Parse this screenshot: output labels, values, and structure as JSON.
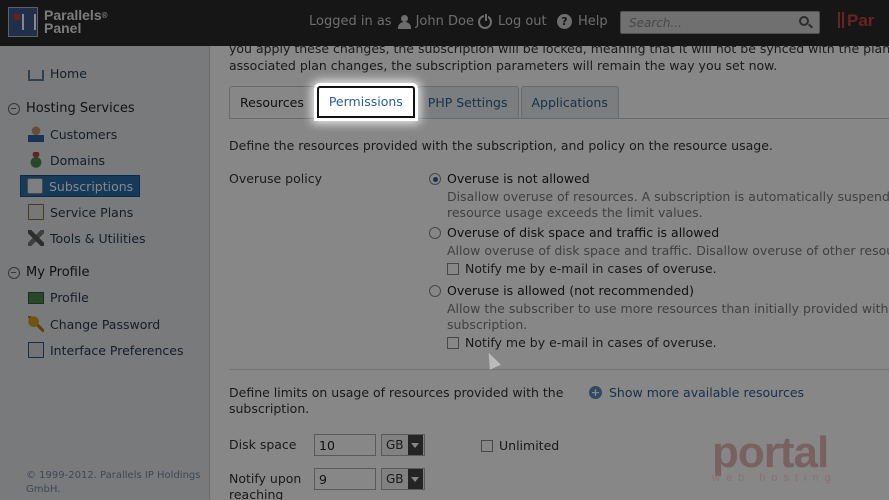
{
  "header": {
    "logo": {
      "line1": "Parallels",
      "sup": "®",
      "line2": "Panel"
    },
    "logged_in_as_label": "Logged in as",
    "user_name": "John Doe",
    "logout_label": "Log out",
    "help_label": "Help",
    "search_placeholder": "Search...",
    "brand_fragment": "Par"
  },
  "sidebar": {
    "home": "Home",
    "hosting_section": "Hosting Services",
    "hosting_items": [
      "Customers",
      "Domains",
      "Subscriptions",
      "Service Plans",
      "Tools & Utilities"
    ],
    "active_item": "Subscriptions",
    "profile_section": "My Profile",
    "profile_items": [
      "Profile",
      "Change Password",
      "Interface Preferences"
    ],
    "copyright": "© 1999-2012. Parallels IP Holdings GmbH."
  },
  "content": {
    "top_note_line1": "you apply these changes, the subscription will be locked, meaning that it will not be synced with the plan. So wh",
    "top_note_line2": "associated plan changes, the subscription parameters will remain the way you set now.",
    "tabs": [
      "Resources",
      "Permissions",
      "PHP Settings",
      "Applications"
    ],
    "active_tab": "Resources",
    "highlighted_tab": "Permissions",
    "description": "Define the resources provided with the subscription, and policy on the resource usage.",
    "overuse_policy_label": "Overuse policy",
    "options": [
      {
        "title": "Overuse is not allowed",
        "checked": true,
        "desc_line1": "Disallow overuse of resources. A subscription is automatically suspended if",
        "desc_line2": "resource usage exceeds the limit values."
      },
      {
        "title": "Overuse of disk space and traffic is allowed",
        "checked": false,
        "desc_line1": "Allow overuse of disk space and traffic. Disallow overuse of other resources",
        "notify": "Notify me by e-mail in cases of overuse."
      },
      {
        "title": "Overuse is allowed (not recommended)",
        "checked": false,
        "desc_line1": "Allow the subscriber to use more resources than initially provided with the",
        "desc_line2": "subscription.",
        "notify": "Notify me by e-mail in cases of overuse."
      }
    ],
    "limits_description": "Define limits on usage of resources provided with the subscription.",
    "show_more": "Show more available resources",
    "disk_space": {
      "label": "Disk space",
      "value": "10",
      "unit": "GB",
      "unlimited_label": "Unlimited"
    },
    "notify_upon": {
      "label": "Notify upon reaching",
      "value": "9",
      "unit": "GB"
    }
  },
  "watermark": {
    "main": "portal",
    "sub": "web hosting"
  }
}
